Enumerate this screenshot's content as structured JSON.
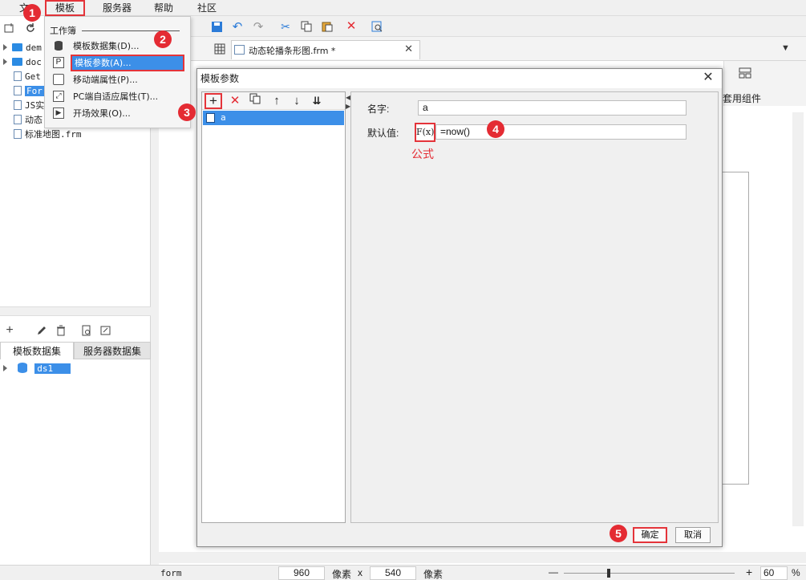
{
  "menu": {
    "file": "文",
    "template": "模板",
    "server": "服务器",
    "help": "帮助",
    "community": "社区"
  },
  "dropdown": {
    "section": "工作簿",
    "items": [
      {
        "label": "模板数据集(D)...",
        "icon": "database-icon"
      },
      {
        "label": "模板参数(A)...",
        "icon": "parameter-icon"
      },
      {
        "label": "移动端属性(P)...",
        "icon": "tablet-icon"
      },
      {
        "label": "PC端自适应属性(T)...",
        "icon": "fit-icon"
      },
      {
        "label": "开场效果(O)...",
        "icon": "play-icon"
      }
    ]
  },
  "tree": {
    "items": [
      {
        "label": "dem",
        "type": "folder",
        "expandable": true
      },
      {
        "label": "doc",
        "type": "folder",
        "expandable": true
      },
      {
        "label": "Get",
        "type": "file"
      },
      {
        "label": "For",
        "type": "file",
        "selected": true
      },
      {
        "label": "JS实",
        "type": "file"
      },
      {
        "label": "动态",
        "type": "file"
      },
      {
        "label": "标准地图.frm",
        "type": "file"
      }
    ]
  },
  "dataset_tabs": {
    "template": "模板数据集",
    "server": "服务器数据集"
  },
  "dataset_tree": {
    "item": "ds1"
  },
  "editor_tab": {
    "label": "动态轮播条形图.frm *"
  },
  "right_panel": {
    "widget_label": "套用组件"
  },
  "dialog": {
    "title": "模板参数",
    "param_item": "a",
    "name_label": "名字:",
    "name_value": "a",
    "default_label": "默认值:",
    "formula_button": "F(x)",
    "default_value": "=now()",
    "formula_caption": "公式",
    "ok": "确定",
    "cancel": "取消"
  },
  "steps": [
    "1",
    "2",
    "3",
    "4",
    "5"
  ],
  "statusbar": {
    "mode": "form",
    "width": "960",
    "unit1": "像素",
    "times": "x",
    "height": "540",
    "unit2": "像素",
    "minus": "—",
    "plus": "+",
    "zoom": "60",
    "percent": "%"
  },
  "colors": {
    "accent": "#e42b33",
    "selection": "#3c8fe8"
  }
}
